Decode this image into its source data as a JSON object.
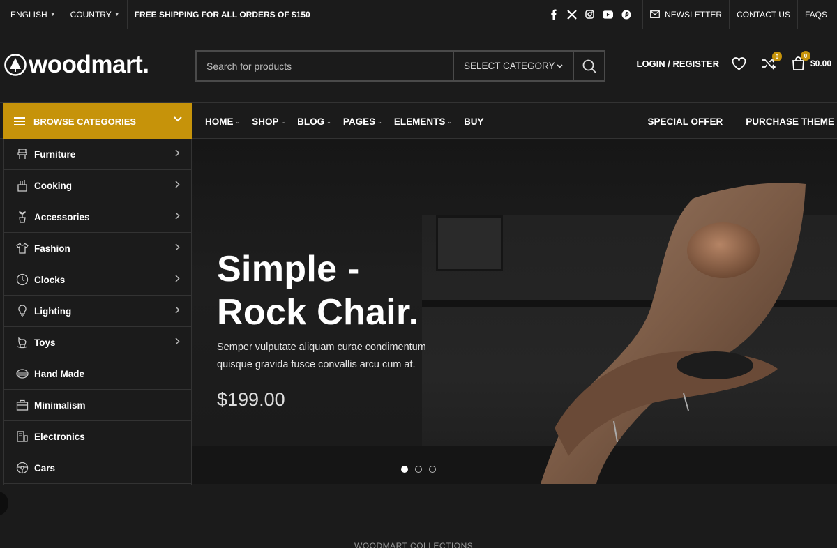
{
  "topbar": {
    "language": "ENGLISH",
    "country": "COUNTRY",
    "shipping": "FREE SHIPPING FOR ALL ORDERS OF $150",
    "newsletter": "NEWSLETTER",
    "contact": "CONTACT US",
    "faqs": "FAQS",
    "socials": [
      "facebook-icon",
      "x-icon",
      "instagram-icon",
      "youtube-icon",
      "pinterest-icon"
    ]
  },
  "header": {
    "logo": "woodmart.",
    "search_placeholder": "Search for products",
    "category": "SELECT CATEGORY",
    "login": "LOGIN / REGISTER",
    "compare_count": "0",
    "cart_count": "0",
    "cart_total": "$0.00"
  },
  "nav": {
    "browse": "BROWSE CATEGORIES",
    "items": [
      "HOME",
      "SHOP",
      "BLOG",
      "PAGES",
      "ELEMENTS",
      "BUY"
    ],
    "special": "SPECIAL OFFER",
    "purchase": "PURCHASE THEME"
  },
  "sidebar": {
    "items": [
      {
        "label": "Furniture"
      },
      {
        "label": "Cooking"
      },
      {
        "label": "Accessories"
      },
      {
        "label": "Fashion"
      },
      {
        "label": "Clocks"
      },
      {
        "label": "Lighting"
      },
      {
        "label": "Toys"
      },
      {
        "label": "Hand Made"
      },
      {
        "label": "Minimalism"
      },
      {
        "label": "Electronics"
      },
      {
        "label": "Cars"
      }
    ]
  },
  "hero": {
    "title_line1": "Simple -",
    "title_line2": "Rock Chair.",
    "description": "Semper vulputate aliquam curae condimentum quisque gravida fusce convallis arcu cum at.",
    "price": "$199.00",
    "slide_count": 3,
    "active_slide": 1
  },
  "section": {
    "label": "WOODMART COLLECTIONS"
  },
  "colors": {
    "accent": "#c6930a",
    "background": "#1b1b1b"
  }
}
